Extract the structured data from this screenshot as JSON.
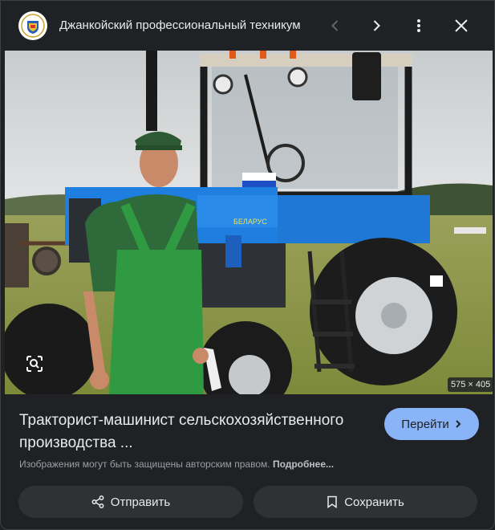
{
  "header": {
    "site_name": "Джанкойский профессиональный техникум",
    "logo_icon": "college-crest-icon"
  },
  "image": {
    "alt": "Тракторист-машинист сельскохозяйственного производства",
    "dimensions": "575 × 405",
    "tractor_brand": "БЕЛАРУС"
  },
  "result": {
    "title_line1": "Тракторист-машинист сельскохозяйственного",
    "title_line2": "производства ...",
    "visit_label": "Перейти"
  },
  "notice": {
    "text": "Изображения могут быть защищены авторским правом.",
    "more_label": "Подробнее..."
  },
  "actions": {
    "share_label": "Отправить",
    "save_label": "Сохранить"
  },
  "colors": {
    "background": "#202124",
    "accent": "#8ab4f8",
    "button_bg": "#303134",
    "tractor_blue": "#1e7fe0"
  }
}
